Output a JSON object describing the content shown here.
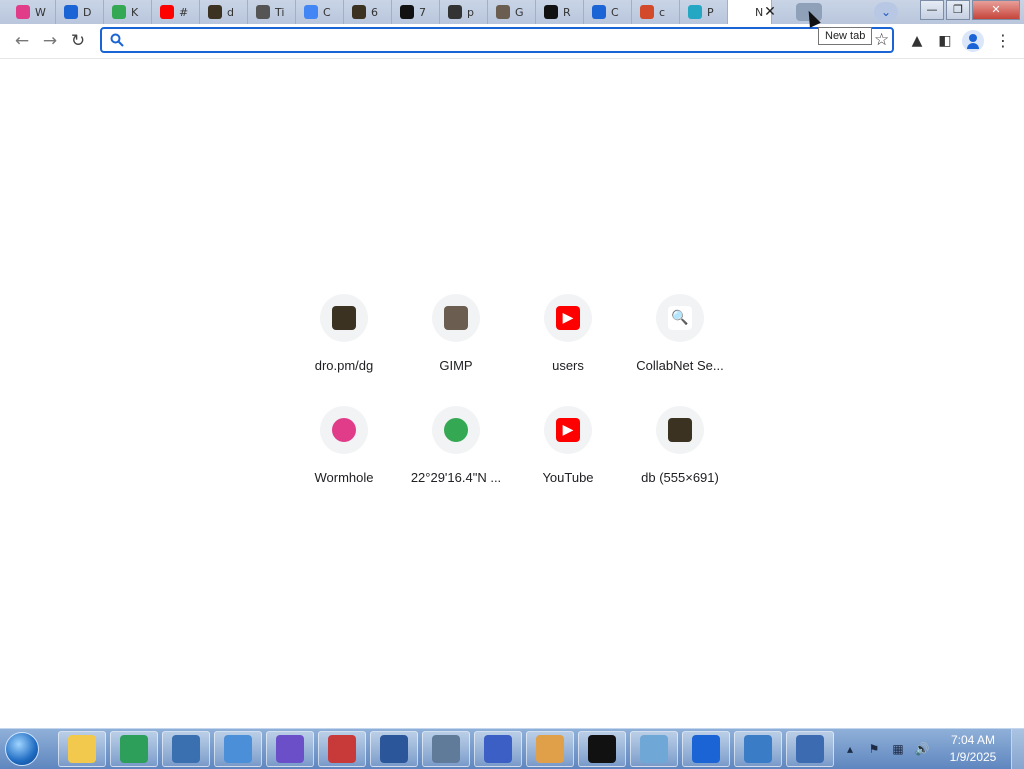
{
  "tabs": [
    {
      "label": "W",
      "icon": "wormhole-icon",
      "color": "#e03c8a"
    },
    {
      "label": "D",
      "icon": "download-icon",
      "color": "#1a64d6"
    },
    {
      "label": "K",
      "icon": "maps-pin-icon",
      "color": "#34a853"
    },
    {
      "label": "#",
      "icon": "youtube-icon",
      "color": "#ff0000"
    },
    {
      "label": "d",
      "icon": "dro-image-icon",
      "color": "#3b3222"
    },
    {
      "label": "Ti",
      "icon": "lightbulb-pin-icon",
      "color": "#555555"
    },
    {
      "label": "C",
      "icon": "chrome-icon",
      "color": "#4285f4"
    },
    {
      "label": "6",
      "icon": "dro-image-icon",
      "color": "#3b3222"
    },
    {
      "label": "7",
      "icon": "sevenzip-icon",
      "color": "#111111"
    },
    {
      "label": "p",
      "icon": "library-icon",
      "color": "#333333"
    },
    {
      "label": "G",
      "icon": "gimp-icon",
      "color": "#6b5d4f"
    },
    {
      "label": "R",
      "icon": "github-icon",
      "color": "#111111"
    },
    {
      "label": "C",
      "icon": "search-icon",
      "color": "#1a64d6"
    },
    {
      "label": "c",
      "icon": "food-bowl-icon",
      "color": "#d24a2a"
    },
    {
      "label": "P",
      "icon": "pypi-icon",
      "color": "#23a7c2"
    },
    {
      "label": "N",
      "icon": "new-tab-icon",
      "color": "#ffffff",
      "active": true
    }
  ],
  "tooltip": "New tab",
  "omnibox": {
    "value": "",
    "placeholder": ""
  },
  "shortcuts": [
    {
      "label": "dro.pm/dg",
      "icon": "dro-image-icon",
      "color": "#3b3222",
      "glyph": ""
    },
    {
      "label": "GIMP",
      "icon": "gimp-icon",
      "color": "#6b5d4f",
      "glyph": ""
    },
    {
      "label": "users",
      "icon": "youtube-icon",
      "color": "#ff0000",
      "glyph": "▶"
    },
    {
      "label": "CollabNet Se...",
      "icon": "search-icon",
      "color": "#ffffff",
      "glyph": "🔍"
    },
    {
      "label": "Wormhole",
      "icon": "wormhole-icon",
      "color": "#e03c8a",
      "glyph": ""
    },
    {
      "label": "22°29'16.4\"N ...",
      "icon": "maps-pin-icon",
      "color": "#34a853",
      "glyph": ""
    },
    {
      "label": "YouTube",
      "icon": "youtube-icon",
      "color": "#ff0000",
      "glyph": "▶"
    },
    {
      "label": "db (555×691)",
      "icon": "dro-image-icon",
      "color": "#3b3222",
      "glyph": ""
    }
  ],
  "taskbar": {
    "apps": [
      {
        "name": "file-explorer-icon",
        "color": "#f2c94c"
      },
      {
        "name": "green-app-icon",
        "color": "#2e9e5b"
      },
      {
        "name": "globe-network-icon",
        "color": "#3a6fb0"
      },
      {
        "name": "usb-drive-icon",
        "color": "#4a8fd8"
      },
      {
        "name": "purple-gear-icon",
        "color": "#6b4fc8"
      },
      {
        "name": "spider-debugger-icon",
        "color": "#c83a3a"
      },
      {
        "name": "word-icon",
        "color": "#2b579a"
      },
      {
        "name": "admin-tools-icon",
        "color": "#607a99"
      },
      {
        "name": "infinity-icon",
        "color": "#3b5fc4"
      },
      {
        "name": "paint-palette-icon",
        "color": "#e0a04a"
      },
      {
        "name": "sevenzip-icon",
        "color": "#111111"
      },
      {
        "name": "notepad-icon",
        "color": "#6fa8d6"
      },
      {
        "name": "exit-arrow-icon",
        "color": "#1a64d6"
      },
      {
        "name": "control-panel-icon",
        "color": "#3a7cc6"
      },
      {
        "name": "virtualbox-icon",
        "color": "#3c6bb2"
      }
    ],
    "time": "7:04 AM",
    "date": "1/9/2025"
  }
}
